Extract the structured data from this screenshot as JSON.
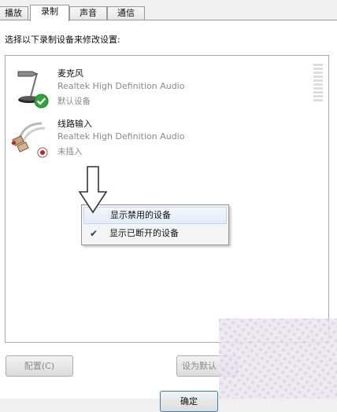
{
  "tabs": [
    {
      "label": "播放",
      "active": false
    },
    {
      "label": "录制",
      "active": true
    },
    {
      "label": "声音",
      "active": false
    },
    {
      "label": "通信",
      "active": false
    }
  ],
  "instruction": "选择以下录制设备来修改设置:",
  "devices": [
    {
      "name": "麦克风",
      "description": "Realtek High Definition Audio",
      "status": "默认设备",
      "icon": "microphone-icon",
      "badge": "default-check-icon"
    },
    {
      "name": "线路输入",
      "description": "Realtek High Definition Audio",
      "status": "未插入",
      "icon": "audio-cable-icon",
      "badge": "unplugged-icon"
    }
  ],
  "context_menu": {
    "items": [
      {
        "label": "显示禁用的设备",
        "checked": false
      },
      {
        "label": "显示已断开的设备",
        "checked": true
      }
    ]
  },
  "buttons": {
    "configure": "配置(C)",
    "set_default": "设为默认",
    "ok": "确定"
  },
  "colors": {
    "badge_green": "#2fa53a",
    "status_gray": "#8a8a8a",
    "check_blue": "#1b3a72"
  }
}
